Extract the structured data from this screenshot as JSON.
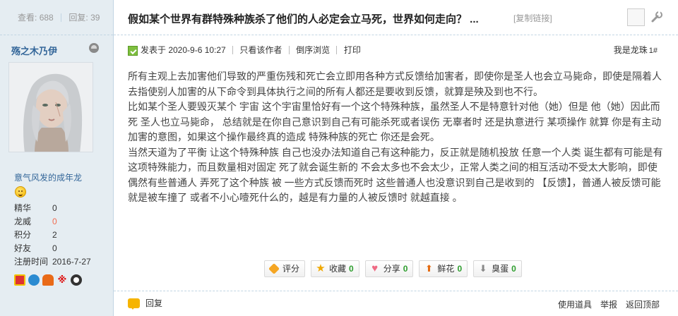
{
  "sidebar": {
    "views_label": "查看:",
    "views": "688",
    "replies_label": "回复:",
    "replies": "39",
    "username": "殇之木乃伊",
    "group": "意气风发的成年龙",
    "profile": [
      {
        "key": "精华",
        "value": "0"
      },
      {
        "key": "龙威",
        "value": "0"
      },
      {
        "key": "积分",
        "value": "2"
      },
      {
        "key": "好友",
        "value": "0"
      },
      {
        "key": "注册时间",
        "value": "2016-7-27"
      }
    ]
  },
  "thread": {
    "title": "假如某个世界有群特殊种族杀了他们的人必定会立马死，世界如何走向？ ...",
    "copy_link": "[复制链接]"
  },
  "post": {
    "posted_at": "发表于 2020-9-6 10:27",
    "only_author": "只看该作者",
    "reverse": "倒序浏览",
    "print": "打印",
    "floor_name": "我是龙珠",
    "floor_num": "1#",
    "paragraphs": [
      "所有主观上去加害他们导致的严重伤残和死亡会立即用各种方式反馈给加害者，即使你是圣人也会立马毙命，即使是隔着人去指使别人加害的从下命令到具体执行之间的所有人都还是要收到反馈，就算是殃及到也不行。",
      "比如某个圣人要毁灭某个 宇宙 这个宇宙里恰好有一个这个特殊种族，虽然圣人不是特意针对他（她）但是 他（她）因此而死 圣人也立马毙命， 总结就是在你自己意识到自己有可能杀死或者误伤 无辜者时 还是执意进行 某项操作 就算 你是有主动加害的意图，如果这个操作最终真的造成 特殊种族的死亡 你还是会死。",
      "当然天道为了平衡 让这个特殊种族 自己也没办法知道自己有这种能力，反正就是随机投放 任意一个人类 诞生都有可能是有这项特殊能力，而且数量相对固定 死了就会诞生新的 不会太多也不会太少，正常人类之间的相互活动不受太大影响，即使偶然有些普通人 弄死了这个种族 被 一些方式反馈而死时 这些普通人也没意识到自己是收到的 【反馈】，普通人被反馈可能就是被车撞了 或者不小心噎死什么的，越是有力量的人被反馈时 就越直接 。"
    ]
  },
  "actions": [
    {
      "label": "评分",
      "count": "",
      "icon": "rate-icon"
    },
    {
      "label": "收藏",
      "count": "0",
      "icon": "star-icon"
    },
    {
      "label": "分享",
      "count": "0",
      "icon": "heart-icon"
    },
    {
      "label": "鲜花",
      "count": "0",
      "icon": "flower-up-icon"
    },
    {
      "label": "臭蛋",
      "count": "0",
      "icon": "egg-down-icon"
    }
  ],
  "footer": {
    "reply": "回复",
    "links": [
      "使用道具",
      "举报",
      "返回顶部"
    ]
  }
}
